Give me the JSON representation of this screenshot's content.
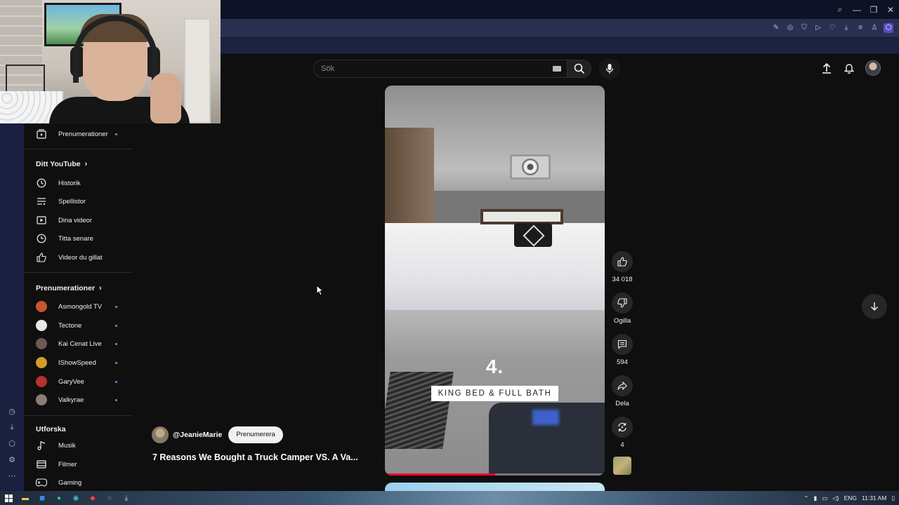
{
  "browser": {
    "window_controls": [
      "search-icon",
      "minimize-icon",
      "restore-icon",
      "close-icon"
    ]
  },
  "search": {
    "placeholder": "Sök"
  },
  "sidebar": {
    "top_item": {
      "label": "Prenumerationer",
      "icon": "subscriptions-icon"
    },
    "you_section": {
      "heading": "Ditt YouTube",
      "items": [
        {
          "label": "Historik",
          "icon": "history-icon"
        },
        {
          "label": "Spellistor",
          "icon": "playlists-icon"
        },
        {
          "label": "Dina videor",
          "icon": "your-videos-icon"
        },
        {
          "label": "Titta senare",
          "icon": "watch-later-icon"
        },
        {
          "label": "Videor du gillat",
          "icon": "liked-videos-icon"
        }
      ]
    },
    "subs_section": {
      "heading": "Prenumerationer",
      "channels": [
        {
          "name": "Asmongold TV",
          "color": "#c8552f"
        },
        {
          "name": "Tectone",
          "color": "#e8e8e8"
        },
        {
          "name": "Kai Cenat Live",
          "color": "#6b5a52"
        },
        {
          "name": "IShowSpeed",
          "color": "#d49a2a"
        },
        {
          "name": "GaryVee",
          "color": "#b8312f"
        },
        {
          "name": "Valkyrae",
          "color": "#8a7c76"
        }
      ]
    },
    "explore_section": {
      "heading": "Utforska",
      "items": [
        {
          "label": "Musik",
          "icon": "music-icon"
        },
        {
          "label": "Filmer",
          "icon": "movies-icon"
        },
        {
          "label": "Gaming",
          "icon": "gaming-icon"
        }
      ]
    }
  },
  "short": {
    "overlay_number": "4.",
    "overlay_caption": "KING BED & FULL BATH",
    "progress": 0.5,
    "channel": "@JeanieMarie",
    "subscribe_label": "Prenumerera",
    "title": "7 Reasons We Bought a Truck Camper VS. A Va..."
  },
  "actions": {
    "like_count": "34 018",
    "dislike_label": "Ogilla",
    "comment_count": "594",
    "share_label": "Dela",
    "remix_count": "4"
  },
  "taskbar": {
    "language": "ENG",
    "time": "11:31 AM"
  },
  "colors": {
    "accent": "#ff0033",
    "background": "#0f0f0f",
    "new_content_dot": "#3ea6ff"
  }
}
